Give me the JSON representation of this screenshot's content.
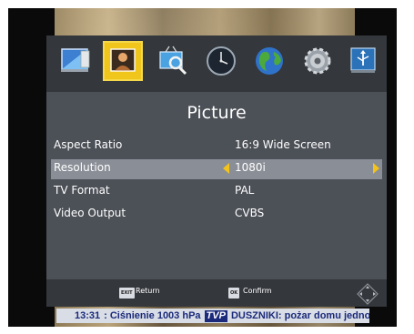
{
  "menu": {
    "icons": [
      {
        "name": "installation-icon"
      },
      {
        "name": "picture-icon"
      },
      {
        "name": "channel-search-icon"
      },
      {
        "name": "time-icon"
      },
      {
        "name": "language-icon"
      },
      {
        "name": "system-settings-icon"
      },
      {
        "name": "usb-icon"
      }
    ],
    "active_icon": "picture-icon",
    "title": "Picture",
    "settings": [
      {
        "label": "Aspect Ratio",
        "value": "16:9 Wide Screen"
      },
      {
        "label": "Resolution",
        "value": "1080i",
        "selected": true
      },
      {
        "label": "TV Format",
        "value": "PAL"
      },
      {
        "label": "Video Output",
        "value": "CVBS"
      }
    ],
    "footer": {
      "exit_key": "EXIT",
      "return_label": "Return",
      "ok_key": "OK",
      "confirm_label": "Confirm"
    },
    "highlight_color": "#f1c61c",
    "accent_arrow_color": "#f4c31a"
  },
  "ticker": {
    "time": "13:31",
    "text1": ": Ciśnienie 1003 hPa",
    "channel_logo": "TVP",
    "text2": "DUSZNIKI: pożar domu jednoro"
  }
}
